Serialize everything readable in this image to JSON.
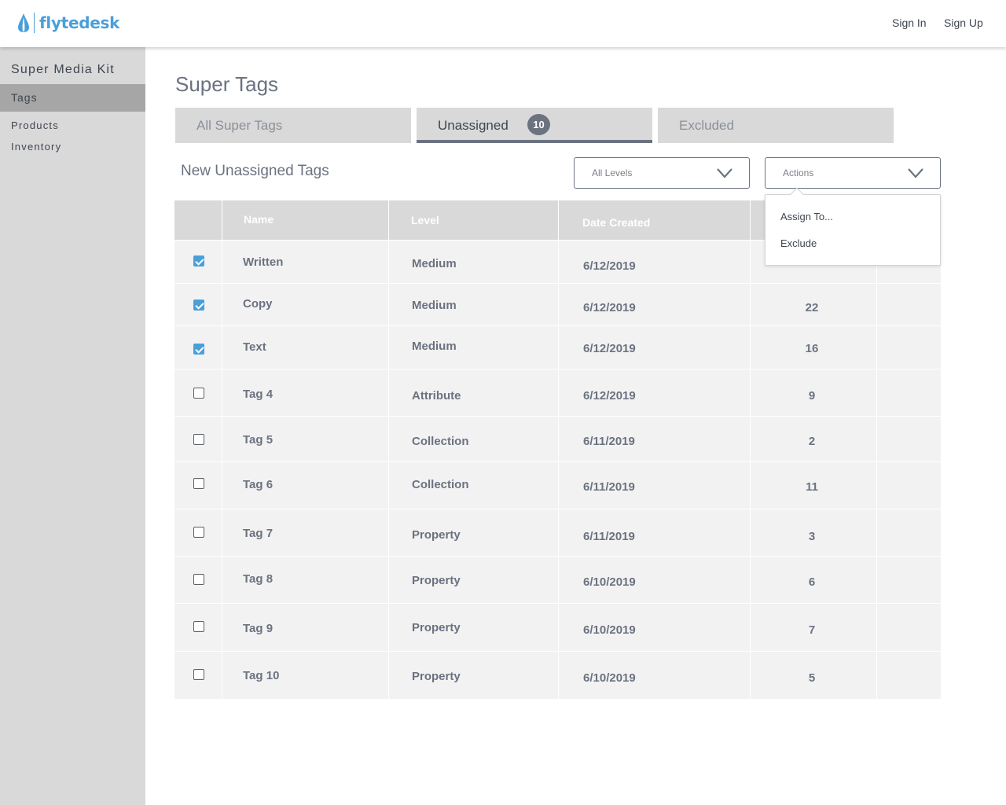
{
  "brand": {
    "name": "flytedesk",
    "color": "#4a9fd9"
  },
  "header": {
    "sign_in": "Sign In",
    "sign_up": "Sign Up"
  },
  "sidebar": {
    "title": "Super Media Kit",
    "items": [
      {
        "label": "Tags",
        "active": true
      },
      {
        "label": "Products",
        "active": false
      },
      {
        "label": "Inventory",
        "active": false
      }
    ]
  },
  "page": {
    "title": "Super Tags"
  },
  "tabs": [
    {
      "label": "All Super Tags"
    },
    {
      "label": "Unassigned",
      "badge": "10",
      "active": true
    },
    {
      "label": "Excluded"
    }
  ],
  "section": {
    "title": "New Unassigned Tags"
  },
  "filters": {
    "level": "All Levels",
    "actions": "Actions"
  },
  "actions_menu": {
    "items": [
      "Assign To...",
      "Exclude"
    ]
  },
  "table": {
    "columns": [
      "Name",
      "Level",
      "Date Created"
    ],
    "rows": [
      {
        "checked": true,
        "name": "Written",
        "level": "Medium",
        "date": "6/12/2019",
        "count": ""
      },
      {
        "checked": true,
        "name": "Copy",
        "level": "Medium",
        "date": "6/12/2019",
        "count": "22"
      },
      {
        "checked": true,
        "name": "Text",
        "level": "Medium",
        "date": "6/12/2019",
        "count": "16"
      },
      {
        "checked": false,
        "name": "Tag 4",
        "level": "Attribute",
        "date": "6/12/2019",
        "count": "9"
      },
      {
        "checked": false,
        "name": "Tag 5",
        "level": "Collection",
        "date": "6/11/2019",
        "count": "2"
      },
      {
        "checked": false,
        "name": "Tag 6",
        "level": "Collection",
        "date": "6/11/2019",
        "count": "11"
      },
      {
        "checked": false,
        "name": "Tag 7",
        "level": "Property",
        "date": "6/11/2019",
        "count": "3"
      },
      {
        "checked": false,
        "name": "Tag 8",
        "level": "Property",
        "date": "6/10/2019",
        "count": "6"
      },
      {
        "checked": false,
        "name": "Tag 9",
        "level": "Property",
        "date": "6/10/2019",
        "count": "7"
      },
      {
        "checked": false,
        "name": "Tag 10",
        "level": "Property",
        "date": "6/10/2019",
        "count": "5"
      }
    ]
  },
  "colors": {
    "accent": "#4a9fd9",
    "sidebar_bg": "#d9d9d9",
    "active_bg": "#a6a6a6",
    "badge_bg": "#6b7280"
  }
}
